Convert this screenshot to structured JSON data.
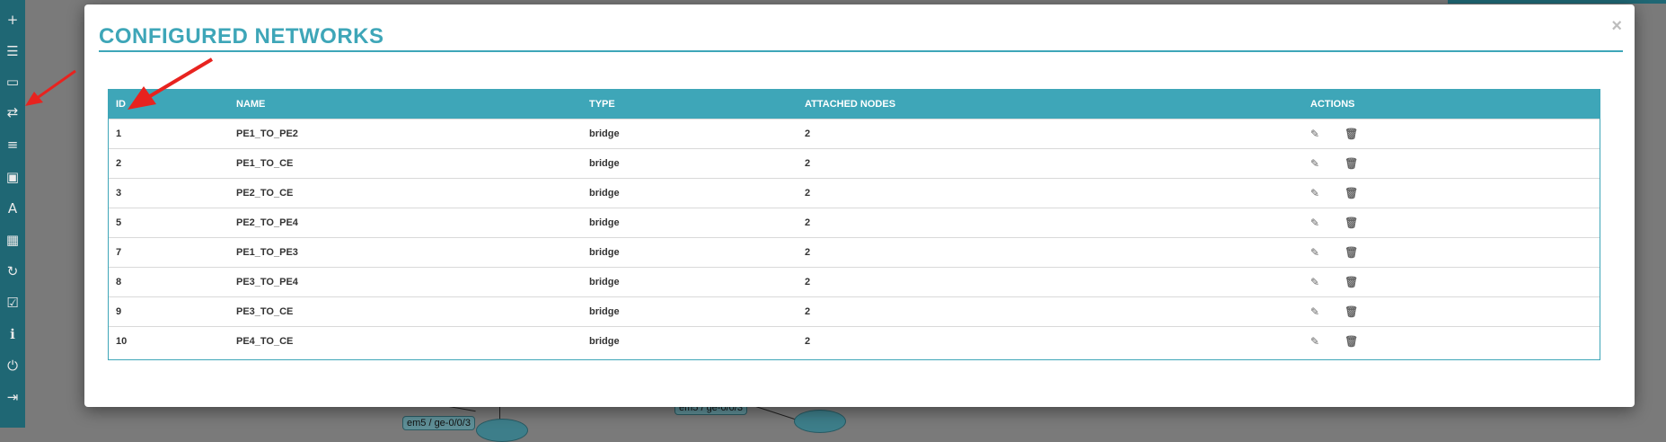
{
  "modal": {
    "title": "CONFIGURED NETWORKS",
    "close_label": "×"
  },
  "table": {
    "headers": [
      "ID",
      "NAME",
      "TYPE",
      "ATTACHED NODES",
      "ACTIONS"
    ],
    "rows": [
      {
        "id": "1",
        "name": "PE1_TO_PE2",
        "type": "bridge",
        "nodes": "2"
      },
      {
        "id": "2",
        "name": "PE1_TO_CE",
        "type": "bridge",
        "nodes": "2"
      },
      {
        "id": "3",
        "name": "PE2_TO_CE",
        "type": "bridge",
        "nodes": "2"
      },
      {
        "id": "5",
        "name": "PE2_TO_PE4",
        "type": "bridge",
        "nodes": "2"
      },
      {
        "id": "7",
        "name": "PE1_TO_PE3",
        "type": "bridge",
        "nodes": "2"
      },
      {
        "id": "8",
        "name": "PE3_TO_PE4",
        "type": "bridge",
        "nodes": "2"
      },
      {
        "id": "9",
        "name": "PE3_TO_CE",
        "type": "bridge",
        "nodes": "2"
      },
      {
        "id": "10",
        "name": "PE4_TO_CE",
        "type": "bridge",
        "nodes": "2"
      }
    ],
    "actions": {
      "edit_icon": "✎",
      "delete_icon": "🗑"
    }
  },
  "background": {
    "label_left": "em5 / ge-0/0/3",
    "label_right": "em5 / ge-0/0/3"
  },
  "sidebar": {
    "tools": [
      {
        "name": "add-icon",
        "glyph": "+"
      },
      {
        "name": "list-icon",
        "glyph": "☰"
      },
      {
        "name": "drive-icon",
        "glyph": "▭"
      },
      {
        "name": "networks-icon",
        "glyph": "⇄"
      },
      {
        "name": "menu-icon",
        "glyph": "≡"
      },
      {
        "name": "image-icon",
        "glyph": "▣"
      },
      {
        "name": "text-icon",
        "glyph": "A"
      },
      {
        "name": "grid-icon",
        "glyph": "▦"
      },
      {
        "name": "refresh-icon",
        "glyph": "↻"
      },
      {
        "name": "check-icon",
        "glyph": "☑"
      },
      {
        "name": "info-icon",
        "glyph": "ℹ"
      },
      {
        "name": "power-icon",
        "glyph": "⏻"
      },
      {
        "name": "logout-icon",
        "glyph": "⇥"
      }
    ]
  },
  "colors": {
    "accent": "#3ea6b8",
    "sidebar": "#1f6774",
    "arrow": "#e8231f"
  }
}
